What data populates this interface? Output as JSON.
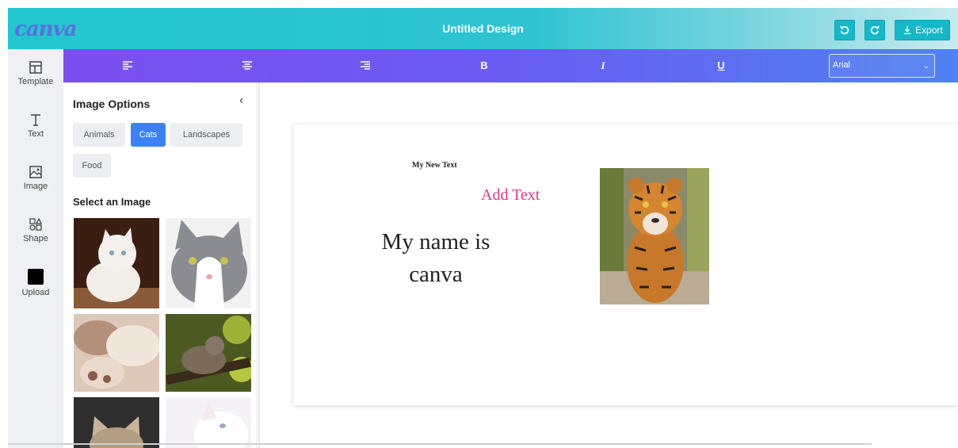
{
  "header": {
    "logo": "canva",
    "title": "Untitled Design",
    "undo_icon": "undo-icon",
    "redo_icon": "redo-icon",
    "export_label": "Export"
  },
  "rail": {
    "items": [
      {
        "label": "Template",
        "icon": "template-icon"
      },
      {
        "label": "Text",
        "icon": "text-icon"
      },
      {
        "label": "Image",
        "icon": "image-icon"
      },
      {
        "label": "Shape",
        "icon": "shape-icon"
      },
      {
        "label": "Upload",
        "icon": "upload-icon"
      }
    ]
  },
  "toolbar": {
    "tools": [
      "align-left-icon",
      "align-center-icon",
      "align-right-icon",
      "bold-icon",
      "italic-icon",
      "underline-icon"
    ],
    "bold_label": "B",
    "italic_label": "I",
    "underline_label": "U",
    "font_value": "Arial"
  },
  "panel": {
    "title": "Image Options",
    "categories": [
      "Animals",
      "Cats",
      "Landscapes",
      "Food"
    ],
    "active_category": "Cats",
    "select_title": "Select an Image"
  },
  "canvas": {
    "text1": "My New Text",
    "text2": "Add Text",
    "text3": "My name is canva"
  },
  "colors": {
    "header_accent": "#22c6cf",
    "toolbar_start": "#7a4ff0",
    "toolbar_end": "#4f82f2",
    "chip_active": "#3b82f6",
    "pink_text": "#e0338f"
  }
}
